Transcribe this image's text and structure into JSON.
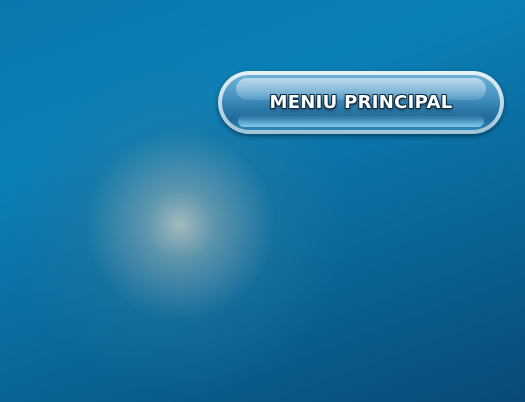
{
  "main_menu": {
    "button_label": "MENIU PRINCIPAL"
  },
  "colors": {
    "background_primary": "#0a78ad",
    "background_dark": "#084a78",
    "button_blue": "#2e7bab",
    "button_border": "#e6f2f8",
    "label_text": "#ffffff"
  }
}
